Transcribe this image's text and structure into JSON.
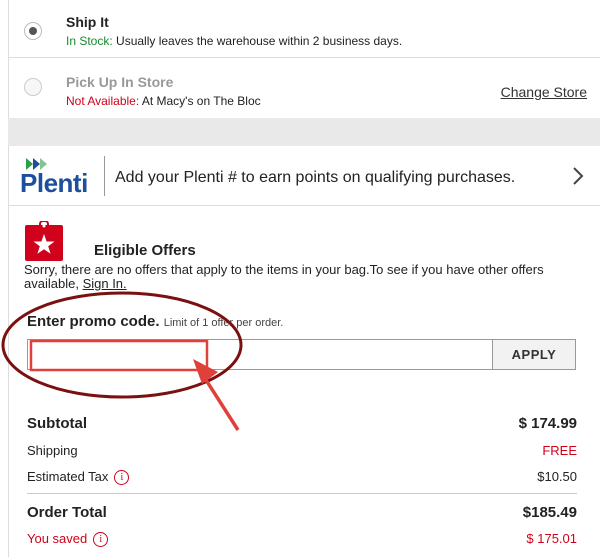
{
  "shipping_options": [
    {
      "title": "Ship It",
      "status": "In Stock:",
      "detail": "Usually leaves the warehouse within 2 business days.",
      "selected": true
    },
    {
      "title": "Pick Up In Store",
      "status": "Not Available:",
      "detail": "At Macy's on The Bloc",
      "selected": false
    }
  ],
  "change_store_label": "Change Store",
  "plenti": {
    "logo_text": "Plenti",
    "message": "Add your Plenti # to earn points on qualifying purchases."
  },
  "offers": {
    "title": "Eligible Offers",
    "message": "Sorry, there are no offers that apply to the items in your bag.To see if you have other offers available,",
    "signin_label": "Sign In."
  },
  "promo": {
    "label": "Enter promo code.",
    "limit": "Limit of 1 offer per order.",
    "value": "",
    "apply_label": "APPLY"
  },
  "summary": {
    "subtotal_label": "Subtotal",
    "subtotal_value": "$ 174.99",
    "shipping_label": "Shipping",
    "shipping_value": "FREE",
    "tax_label": "Estimated Tax",
    "tax_value": "$10.50",
    "total_label": "Order Total",
    "total_value": "$185.49",
    "saved_label": "You saved",
    "saved_value": "$ 175.01"
  },
  "colors": {
    "green": "#1a8a2e",
    "red": "#d0021b",
    "plenti_blue": "#1d4f9c",
    "annotation_ellipse": "#7a1010",
    "annotation_arrow": "#e0403a"
  }
}
